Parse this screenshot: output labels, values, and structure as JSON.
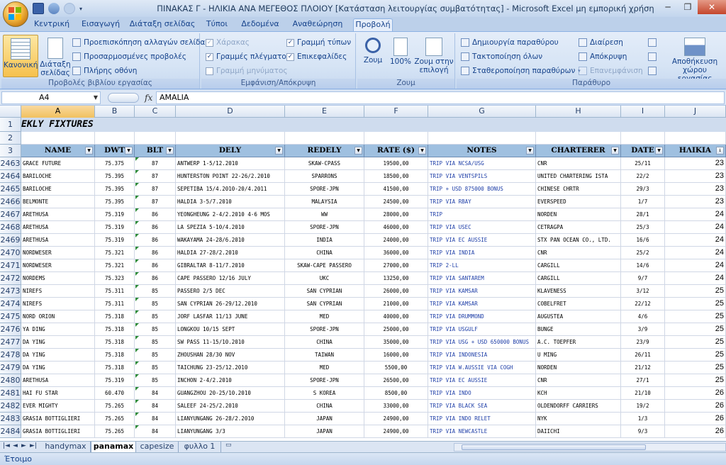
{
  "window": {
    "title": "ΠΙΝΑΚΑΣ Γ - ΗΛΙΚΙΑ ΑΝΑ ΜΕΓΕΘΟΣ ΠΛΟΙΟΥ  [Κατάσταση λειτουργίας συμβατότητας] - Microsoft Excel μη εμπορική χρήση",
    "minimize": "─",
    "restore": "❐",
    "close": "✕"
  },
  "tabs": [
    "Κεντρική",
    "Εισαγωγή",
    "Διάταξη σελίδας",
    "Τύποι",
    "Δεδομένα",
    "Αναθεώρηση",
    "Προβολή"
  ],
  "active_tab": "Προβολή",
  "ribbon": {
    "workbook_views": {
      "label": "Προβολές βιβλίου εργασίας",
      "normal": "Κανονική",
      "page_layout": "Διάταξη σελίδας",
      "page_break": "Προεπισκόπηση αλλαγών σελίδας",
      "custom_views": "Προσαρμοσμένες προβολές",
      "full_screen": "Πλήρης οθόνη"
    },
    "show_hide": {
      "label": "Εμφάνιση/Απόκρυψη",
      "ruler": "Χάρακας",
      "gridlines": "Γραμμές πλέγματος",
      "message_bar": "Γραμμή μηνύματος",
      "formula_bar": "Γραμμή τύπων",
      "headings": "Επικεφαλίδες"
    },
    "zoom": {
      "label": "Ζουμ",
      "zoom": "Ζουμ",
      "hundred": "100%",
      "zoom_selection": "Ζουμ στην επιλογή"
    },
    "window": {
      "label": "Παράθυρο",
      "new_window": "Δημιουργία παραθύρου",
      "arrange_all": "Τακτοποίηση όλων",
      "freeze_panes": "Σταθεροποίηση παραθύρων",
      "split": "Διαίρεση",
      "hide": "Απόκρυψη",
      "unhide": "Επανεμφάνιση",
      "save_workspace": "Αποθήκευση χώρου εργασίας"
    }
  },
  "formula_bar": {
    "name_box": "A4",
    "fx": "fx",
    "value": "AMALIA"
  },
  "columns": [
    "A",
    "B",
    "C",
    "D",
    "E",
    "F",
    "G",
    "H",
    "I",
    "J"
  ],
  "selected_column": "A",
  "row1": {
    "number": "1",
    "title": "EKLY FIXTURES"
  },
  "row2": {
    "number": "2"
  },
  "row3": {
    "number": "3",
    "headers": [
      "NAME",
      "DWT",
      "BLT",
      "DELY",
      "REDELY",
      "RATE ($)",
      "NOTES",
      "CHARTERER",
      "DATE",
      "ΗΛΙΚΙΑ"
    ]
  },
  "rows": [
    {
      "n": "2463",
      "name": "GRACE FUTURE",
      "dwt": "75.375",
      "blt": "87",
      "dely": "ANTWERP 1-5/12.2010",
      "redely": "SKAW-CPASS",
      "rate": "19500,00",
      "notes": "TRIP VIA NCSA/USG",
      "charterer": "CNR",
      "date": "25/11",
      "age": "23"
    },
    {
      "n": "2464",
      "name": "BARILOCHE",
      "dwt": "75.395",
      "blt": "87",
      "dely": "HUNTERSTON POINT 22-26/2.2010",
      "redely": "SPARRONS",
      "rate": "18500,00",
      "notes": "TRIP VIA VENTSPILS",
      "charterer": "UNITED CHARTERING ISTA",
      "date": "22/2",
      "age": "23"
    },
    {
      "n": "2465",
      "name": "BARILOCHE",
      "dwt": "75.395",
      "blt": "87",
      "dely": "SEPETIBA 15/4.2010-20/4.2011",
      "redely": "SPORE-JPN",
      "rate": "41500,00",
      "notes": "TRIP + USD 875000 BONUS",
      "charterer": "CHINESE CHRTR",
      "date": "29/3",
      "age": "23"
    },
    {
      "n": "2466",
      "name": "BELMONTE",
      "dwt": "75.395",
      "blt": "87",
      "dely": "HALDIA 3-5/7.2010",
      "redely": "MALAYSIA",
      "rate": "24500,00",
      "notes": "TRIP VIA RBAY",
      "charterer": "EVERSPEED",
      "date": "1/7",
      "age": "23"
    },
    {
      "n": "2467",
      "name": "ARETHUSA",
      "dwt": "75.319",
      "blt": "86",
      "dely": "YEONGHEUNG 2-4/2.2010 4-6 MOS",
      "redely": "WW",
      "rate": "28000,00",
      "notes": "TRIP",
      "charterer": "NORDEN",
      "date": "28/1",
      "age": "24"
    },
    {
      "n": "2468",
      "name": "ARETHUSA",
      "dwt": "75.319",
      "blt": "86",
      "dely": "LA SPEZIA 5-10/4.2010",
      "redely": "SPORE-JPN",
      "rate": "46000,00",
      "notes": "TRIP VIA USEC",
      "charterer": "CETRAGPA",
      "date": "25/3",
      "age": "24"
    },
    {
      "n": "2469",
      "name": "ARETHUSA",
      "dwt": "75.319",
      "blt": "86",
      "dely": "WAKAYAMA 24-28/6.2010",
      "redely": "INDIA",
      "rate": "24000,00",
      "notes": "TRIP VIA EC AUSSIE",
      "charterer": "STX PAN OCEAN CO., LTD.",
      "date": "16/6",
      "age": "24"
    },
    {
      "n": "2470",
      "name": "NORDWESER",
      "dwt": "75.321",
      "blt": "86",
      "dely": "HALDIA 27-28/2.2010",
      "redely": "CHINA",
      "rate": "36000,00",
      "notes": "TRIP VIA INDIA",
      "charterer": "CNR",
      "date": "25/2",
      "age": "24"
    },
    {
      "n": "2471",
      "name": "NORDWESER",
      "dwt": "75.321",
      "blt": "86",
      "dely": "GIBRALTAR 8-11/7.2010",
      "redely": "SKAW-CAPE PASSERO",
      "rate": "27000,00",
      "notes": "TRIP 2-LL",
      "charterer": "CARGILL",
      "date": "14/6",
      "age": "24"
    },
    {
      "n": "2472",
      "name": "NORDEMS",
      "dwt": "75.323",
      "blt": "86",
      "dely": "CAPE PASSERO 12/16 JULY",
      "redely": "UKC",
      "rate": "13250,00",
      "notes": "TRIP VIA SANTAREM",
      "charterer": "CARGILL",
      "date": "9/7",
      "age": "24"
    },
    {
      "n": "2473",
      "name": "NIREFS",
      "dwt": "75.311",
      "blt": "85",
      "dely": "PASSERO 2/5 DEC",
      "redely": "SAN CYPRIAN",
      "rate": "26000,00",
      "notes": "TRIP VIA KAMSAR",
      "charterer": "KLAVENESS",
      "date": "3/12",
      "age": "25"
    },
    {
      "n": "2474",
      "name": "NIREFS",
      "dwt": "75.311",
      "blt": "85",
      "dely": "SAN CYPRIAN 26-29/12.2010",
      "redely": "SAN CYPRIAN",
      "rate": "21000,00",
      "notes": "TRIP VIA KAMSAR",
      "charterer": "COBELFRET",
      "date": "22/12",
      "age": "25"
    },
    {
      "n": "2475",
      "name": "NORD ORION",
      "dwt": "75.318",
      "blt": "85",
      "dely": "JORF LASFAR 11/13 JUNE",
      "redely": "MED",
      "rate": "40000,00",
      "notes": "TRIP VIA DRUMMOND",
      "charterer": "AUGUSTEA",
      "date": "4/6",
      "age": "25"
    },
    {
      "n": "2476",
      "name": "YA DING",
      "dwt": "75.318",
      "blt": "85",
      "dely": "LONGKOU 10/15 SEPT",
      "redely": "SPORE-JPN",
      "rate": "25000,00",
      "notes": "TRIP VIA USGULF",
      "charterer": "BUNGE",
      "date": "3/9",
      "age": "25"
    },
    {
      "n": "2477",
      "name": "DA YING",
      "dwt": "75.318",
      "blt": "85",
      "dely": "SW PASS 11-15/10.2010",
      "redely": "CHINA",
      "rate": "35000,00",
      "notes": "TRIP VIA USG + USD 650000 BONUS",
      "charterer": "A.C. TOEPFER",
      "date": "23/9",
      "age": "25"
    },
    {
      "n": "2478",
      "name": "DA YING",
      "dwt": "75.318",
      "blt": "85",
      "dely": "ZHOUSHAN 28/30 NOV",
      "redely": "TAIWAN",
      "rate": "16000,00",
      "notes": "TRIP VIA INDONESIA",
      "charterer": "U MING",
      "date": "26/11",
      "age": "25"
    },
    {
      "n": "2479",
      "name": "DA YING",
      "dwt": "75.318",
      "blt": "85",
      "dely": "TAICHUNG 23-25/12.2010",
      "redely": "MED",
      "rate": "5500,00",
      "notes": "TRIP VIA W.AUSSIE VIA COGH",
      "charterer": "NORDEN",
      "date": "21/12",
      "age": "25"
    },
    {
      "n": "2480",
      "name": "ARETHUSA",
      "dwt": "75.319",
      "blt": "85",
      "dely": "INCHON 2-4/2.2010",
      "redely": "SPORE-JPN",
      "rate": "26500,00",
      "notes": "TRIP VIA EC AUSSIE",
      "charterer": "CNR",
      "date": "27/1",
      "age": "25"
    },
    {
      "n": "2481",
      "name": "HAI FU STAR",
      "dwt": "60.470",
      "blt": "84",
      "dely": "GUANGZHOU 20-25/10.2010",
      "redely": "S KOREA",
      "rate": "8500,00",
      "notes": "TRIP VIA INDO",
      "charterer": "KCH",
      "date": "21/10",
      "age": "26"
    },
    {
      "n": "2482",
      "name": "EVER MIGHTY",
      "dwt": "75.265",
      "blt": "84",
      "dely": "SALEEF 24-25/2.2010",
      "redely": "CHINA",
      "rate": "33000,00",
      "notes": "TRIP VIA BLACK SEA",
      "charterer": "OLDENDORFF CARRIERS",
      "date": "19/2",
      "age": "26"
    },
    {
      "n": "2483",
      "name": "GRASIA BOTTIGLIERI",
      "dwt": "75.265",
      "blt": "84",
      "dely": "LIANYUNGANG 26-28/2.2010",
      "redely": "JAPAN",
      "rate": "24900,00",
      "notes": "TRIP VIA INDO RELET",
      "charterer": "NYK",
      "date": "1/3",
      "age": "26"
    },
    {
      "n": "2484",
      "name": "GRASIA BOTTIGLIERI",
      "dwt": "75.265",
      "blt": "84",
      "dely": "LIANYUNGANG 3/3",
      "redely": "JAPAN",
      "rate": "24900,00",
      "notes": "TRIP VIA NEWCASTLE",
      "charterer": "DAIICHI",
      "date": "9/3",
      "age": "26"
    }
  ],
  "sheets": [
    "handymax",
    "panamax",
    "capesize",
    "φυλλο 1"
  ],
  "active_sheet": "panamax",
  "status": "Έτοιμο"
}
